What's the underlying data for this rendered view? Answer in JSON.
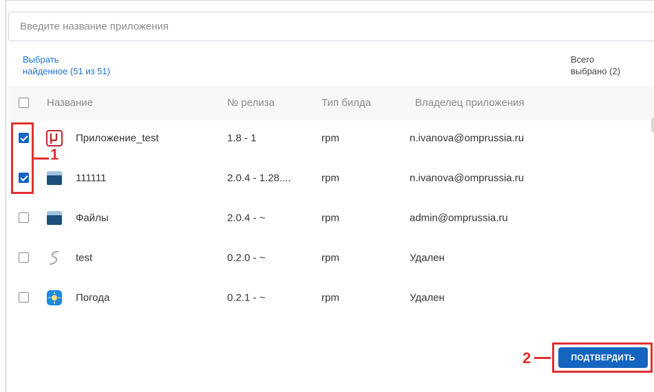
{
  "search": {
    "placeholder": "Введите название приложения",
    "value": ""
  },
  "select_found": {
    "line1": "Выбрать",
    "line2": "найденное (51 из 51)"
  },
  "total_selected": {
    "line1": "Всего",
    "line2": "выбрано (2)"
  },
  "table": {
    "headers": {
      "name": "Название",
      "release": "№ релиза",
      "build_type": "Тип билда",
      "owner": "Владелец приложения"
    },
    "rows": [
      {
        "checked": true,
        "icon": "red-p-app-icon",
        "name": "Приложение_test",
        "release": "1.8 - 1",
        "build_type": "rpm",
        "owner": "n.ivanova@omprussia.ru"
      },
      {
        "checked": true,
        "icon": "folder-app-icon",
        "name": "111111",
        "release": "2.0.4 - 1.28....",
        "build_type": "rpm",
        "owner": "n.ivanova@omprussia.ru"
      },
      {
        "checked": false,
        "icon": "folder-app-icon",
        "name": "Файлы",
        "release": "2.0.4 - ~",
        "build_type": "rpm",
        "owner": "admin@omprussia.ru"
      },
      {
        "checked": false,
        "icon": "grey-s-app-icon",
        "name": "test",
        "release": "0.2.0 - ~",
        "build_type": "rpm",
        "owner": "Удален"
      },
      {
        "checked": false,
        "icon": "weather-app-icon",
        "name": "Погода",
        "release": "0.2.1 - ~",
        "build_type": "rpm",
        "owner": "Удален"
      }
    ]
  },
  "annotations": {
    "callout1": "1",
    "callout2": "2"
  },
  "confirm_label": "ПОДТВЕРДИТЬ",
  "colors": {
    "accent": "#1565c0",
    "link": "#1f6fd1",
    "callout": "#e03030"
  }
}
